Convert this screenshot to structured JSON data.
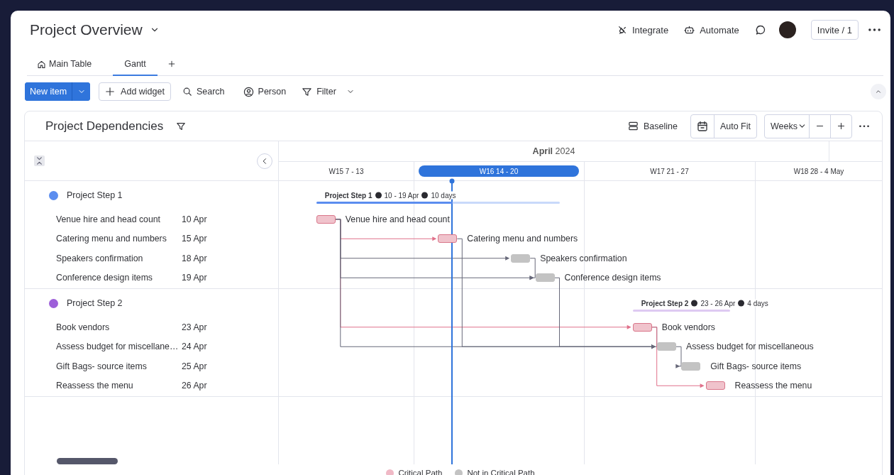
{
  "header": {
    "title": "Project Overview",
    "actions": [
      {
        "kind": "integrate",
        "label": "Integrate"
      },
      {
        "kind": "automate",
        "label": "Automate"
      }
    ],
    "invite": "Invite / 1"
  },
  "tabs": [
    {
      "label": "Main Table",
      "kind": "home",
      "selected": false
    },
    {
      "label": "Gantt",
      "kind": "plain",
      "selected": true
    }
  ],
  "toolbar": {
    "new_item": "New item",
    "add_widget": "Add widget",
    "search": "Search",
    "person": "Person",
    "filter": "Filter"
  },
  "panel": {
    "title": "Project Dependencies",
    "baseline": "Baseline",
    "auto_fit": "Auto Fit",
    "scale": "Weeks"
  },
  "timeline": {
    "month": "**April** 2024",
    "weeks": [
      {
        "label": "W15 7 - 13",
        "selected": false
      },
      {
        "label": "W16 14 - 20",
        "selected": true
      },
      {
        "label": "W17 21 - 27",
        "selected": false
      },
      {
        "label": "W18 28 - 4 May",
        "selected": false
      }
    ]
  },
  "groups": [
    {
      "name": "Project Step 1",
      "color": "#5b8def",
      "chart_title": "Project Step 1",
      "dates": "10 - 19 Apr",
      "duration": "10 days",
      "level": 0.56,
      "tasks": [
        {
          "name": "Venue hire and head count",
          "date": "10 Apr",
          "chart_label": "Venue hire and head count",
          "critical": true
        },
        {
          "name": "Catering menu and numbers",
          "date": "15 Apr",
          "chart_label": "Catering menu and numbers",
          "critical": true
        },
        {
          "name": "Speakers confirmation",
          "date": "18 Apr",
          "chart_label": "Speakers confirmation",
          "critical": false
        },
        {
          "name": "Conference design items",
          "date": "19 Apr",
          "chart_label": "Conference design items",
          "critical": false
        }
      ]
    },
    {
      "name": "Project Step 2",
      "color": "#9d5fd9",
      "chart_title": "Project Step 2",
      "dates": "23 - 26 Apr",
      "duration": "4 days",
      "level": 0,
      "tasks": [
        {
          "name": "Book vendors",
          "date": "23 Apr",
          "chart_label": "Book vendors",
          "critical": true
        },
        {
          "name": "Assess budget for miscellane…",
          "date": "24 Apr",
          "chart_label": "Assess budget for miscellaneous",
          "critical": false
        },
        {
          "name": "Gift Bags- source items",
          "date": "25 Apr",
          "chart_label": "Gift Bags- source items",
          "critical": false
        },
        {
          "name": "Reassess the menu",
          "date": "26 Apr",
          "chart_label": "Reassess the menu",
          "critical": true
        }
      ]
    }
  ],
  "legend": [
    {
      "label": "Critical Path",
      "color": "#f0b9c6"
    },
    {
      "label": "Not in Critical Path",
      "color": "#c3c3c3"
    }
  ]
}
